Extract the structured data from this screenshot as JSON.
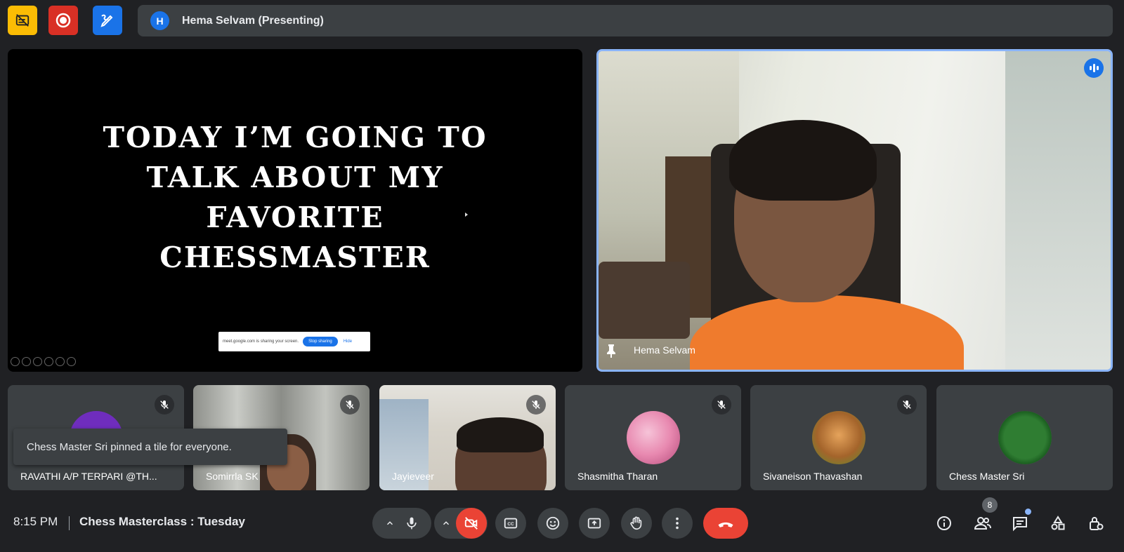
{
  "colors": {
    "background": "#202124",
    "surface": "#3c4043",
    "accent": "#8ab4f8",
    "danger": "#ea4335",
    "primary": "#1a73e8"
  },
  "topbar": {
    "presenter_initial": "H",
    "presenting_label": "Hema Selvam (Presenting)"
  },
  "slide": {
    "title_lines": [
      "Today I’m going to",
      "talk about my",
      "favorite",
      "chessmaster"
    ],
    "share_popup": {
      "message": "meet.google.com is sharing your screen.",
      "stop_label": "Stop sharing",
      "hide_label": "Hide"
    }
  },
  "speaker": {
    "name": "Hema Selvam"
  },
  "participants": [
    {
      "name": "RAVATHI A/P TERPARI @TH..."
    },
    {
      "name": "Somirrla SK"
    },
    {
      "name": "Jayieveer"
    },
    {
      "name": "Shasmitha Tharan"
    },
    {
      "name": "Sivaneison Thavashan"
    },
    {
      "name": "Chess Master Sri"
    }
  ],
  "toast": {
    "message": "Chess Master Sri pinned a tile for everyone."
  },
  "bottombar": {
    "time": "8:15 PM",
    "meeting_title": "Chess Masterclass : Tuesday",
    "people_count": "8"
  },
  "icons": [
    "caption-off-icon",
    "record-icon",
    "whiteboard-icon",
    "chevron-up-icon",
    "mic-icon",
    "camera-off-icon",
    "captions-icon",
    "emoji-icon",
    "present-icon",
    "raise-hand-icon",
    "more-icon",
    "end-call-icon",
    "info-icon",
    "people-icon",
    "chat-icon",
    "activities-icon",
    "host-controls-icon",
    "pin-icon",
    "mic-off-icon"
  ]
}
